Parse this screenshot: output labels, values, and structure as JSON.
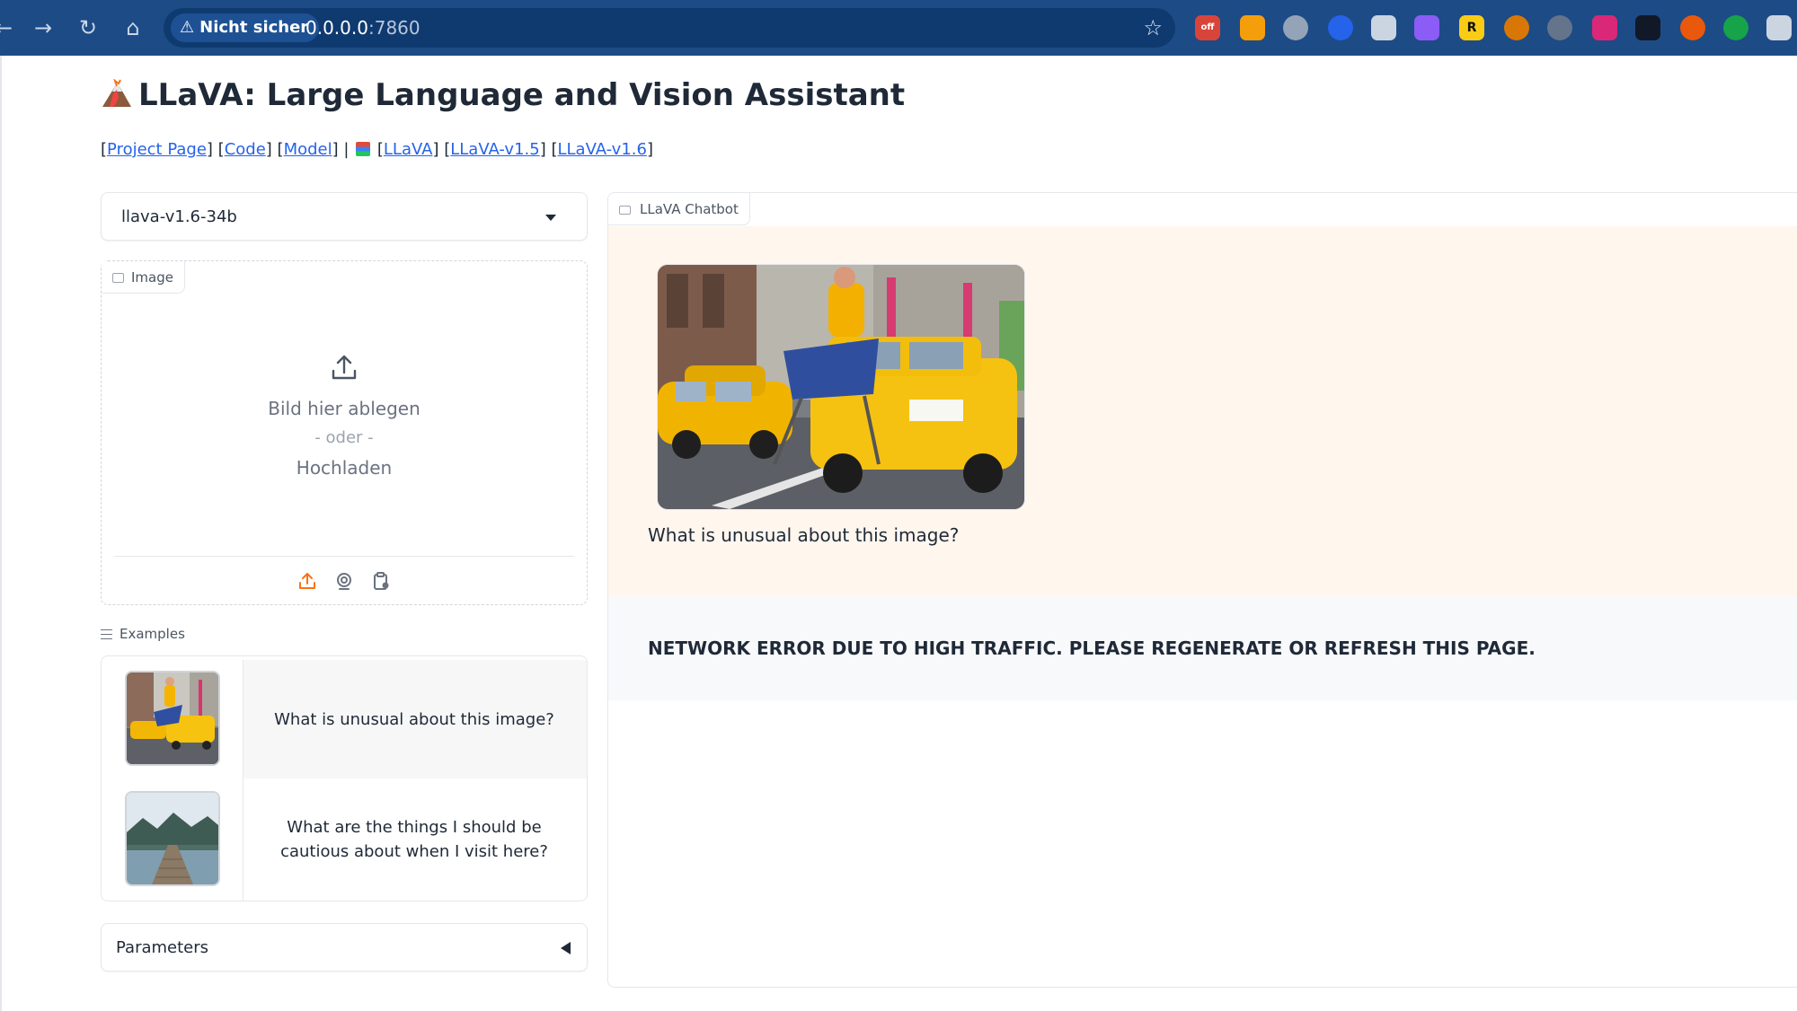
{
  "browser": {
    "security_label": "Nicht sicher",
    "url_host": "0.0.0.0",
    "url_port": ":7860"
  },
  "page": {
    "title": "LLaVA: Large Language and Vision Assistant",
    "links": [
      {
        "label": "Project Page"
      },
      {
        "label": "Code"
      },
      {
        "label": "Model"
      },
      {
        "label": "LLaVA"
      },
      {
        "label": "LLaVA-v1.5"
      },
      {
        "label": "LLaVA-v1.6"
      }
    ]
  },
  "model_selector": {
    "selected": "llava-v1.6-34b"
  },
  "image_upload": {
    "label": "Image",
    "drop_text": "Bild hier ablegen",
    "or_text": "- oder -",
    "upload_text": "Hochladen",
    "accent_color": "#f97316"
  },
  "examples": {
    "label": "Examples",
    "items": [
      {
        "text": "What is unusual about this image?",
        "thumb_icon": "taxi-ironing-photo"
      },
      {
        "text": "What are the things I should be cautious about when I visit here?",
        "thumb_icon": "lake-pier-photo"
      }
    ]
  },
  "parameters": {
    "label": "Parameters"
  },
  "chatbot": {
    "label": "LLaVA Chatbot",
    "messages": [
      {
        "role": "user",
        "text": "What is unusual about this image?",
        "image_icon": "taxi-ironing-photo",
        "background": "#fff6ee"
      },
      {
        "role": "bot",
        "text": "NETWORK ERROR DUE TO HIGH TRAFFIC. PLEASE REGENERATE OR REFRESH THIS PAGE.",
        "background": "#f8f9fb"
      }
    ]
  }
}
